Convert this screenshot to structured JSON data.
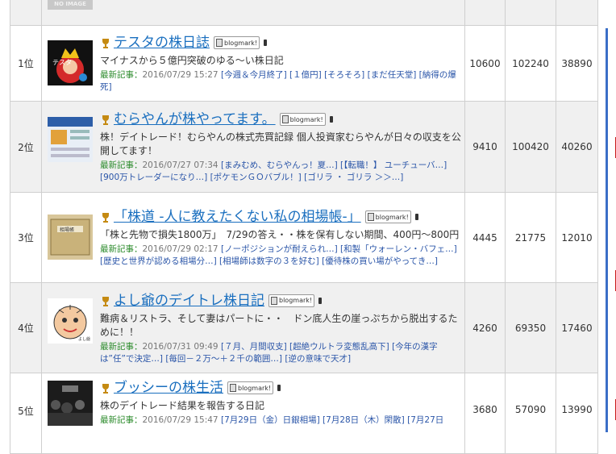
{
  "top_row": {
    "noimage_label": "NO IMAGE"
  },
  "blogmark_label": "blogmark!",
  "latest_label": "最新記事：",
  "rows": [
    {
      "rank": "1位",
      "title": "テスタの株日誌",
      "desc": "マイナスから５億円突破のゆる～い株日記",
      "date": "2016/07/29 15:27",
      "articles": [
        "[今週＆今月終了]",
        "[１億円]",
        "[そろそろ]",
        "[まだ任天堂]",
        "[納得の爆死]"
      ],
      "in": "10600",
      "out": "102240",
      "pv": "38890"
    },
    {
      "rank": "2位",
      "title": "むらやんが株やってます。",
      "desc": "株！デイトレード！むらやんの株式売買記録 個人投資家むらやんが日々の収支を公開してます！",
      "date": "2016/07/27 07:34",
      "articles": [
        "[まみむめ、むらやんっ！夏…]",
        "[【転職！】 ユーチューバ…]",
        "[900万トレーダーになり…]",
        "[ポケモンＧＯバブル！]",
        "[ゴリラ ・ ゴリラ ＞＞…]"
      ],
      "in": "9410",
      "out": "100420",
      "pv": "40260"
    },
    {
      "rank": "3位",
      "title": "「株道 -人に教えたくない私の相場帳-」",
      "desc": "「株と先物で損失1800万」　7/29の答え・・株を保有しない期間、400円～800円",
      "date": "2016/07/29 02:17",
      "articles": [
        "[ノーポジションが耐えられ…]",
        "[和製「ウォーレン・バフェ…]",
        "[歴史と世界が認める相場分…]",
        "[相場師は数字の３を好む]",
        "[優待株の買い場がやってき…]"
      ],
      "in": "4445",
      "out": "21775",
      "pv": "12010"
    },
    {
      "rank": "4位",
      "title": "よし爺のデイトレ株日記",
      "desc": "難病＆リストラ、そして妻はパートに・・　ドン底人生の崖っぷちから脱出するために！！",
      "date": "2016/07/31 09:49",
      "articles": [
        "[７月、月間収支]",
        "[超絶ウルトラ変態乱高下]",
        "[今年の漢字は”任”で決定…]",
        "[毎回－２万～＋２千の範囲…]",
        "[逆の意味で天才]"
      ],
      "in": "4260",
      "out": "69350",
      "pv": "17460"
    },
    {
      "rank": "5位",
      "title": "ブッシーの株生活",
      "desc": "株のデイトレード結果を報告する日記",
      "date": "2016/07/29 15:47",
      "articles": [
        "[7月29日（金）日銀相場]",
        "[7月28日（木）閑散]",
        "[7月27日"
      ],
      "in": "3680",
      "out": "57090",
      "pv": "13990"
    }
  ]
}
